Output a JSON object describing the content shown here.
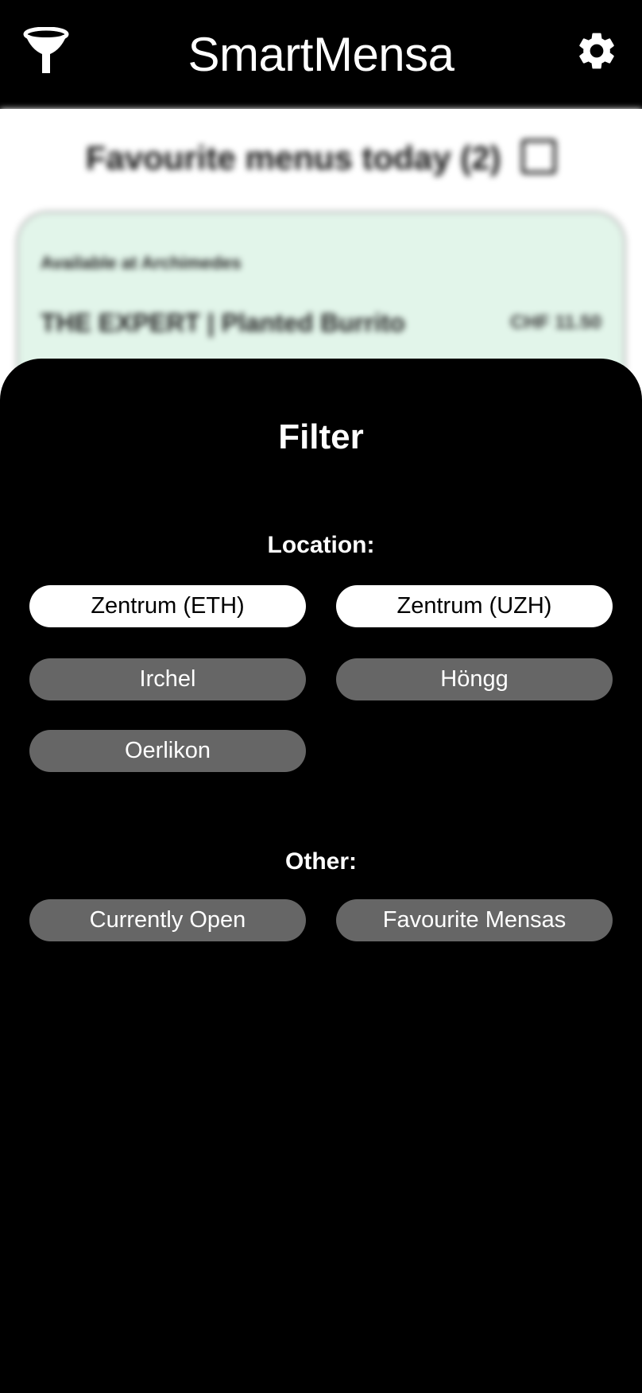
{
  "app": {
    "title": "SmartMensa",
    "filter_icon": "filter-funnel-icon",
    "settings_icon": "gear-icon"
  },
  "background": {
    "favourites_heading": "Favourite menus today (2)",
    "edit_icon": "edit-icon",
    "card": {
      "availability": "Available at Archimedes",
      "menu_name": "THE EXPERT | Planted Burrito",
      "price": "CHF 11.50"
    }
  },
  "filter_sheet": {
    "title": "Filter",
    "location_label": "Location:",
    "locations": [
      {
        "label": "Zentrum (ETH)",
        "selected": true
      },
      {
        "label": "Zentrum (UZH)",
        "selected": true
      },
      {
        "label": "Irchel",
        "selected": false
      },
      {
        "label": "Höngg",
        "selected": false
      },
      {
        "label": "Oerlikon",
        "selected": false
      }
    ],
    "other_label": "Other:",
    "other": [
      {
        "label": "Currently Open",
        "selected": false
      },
      {
        "label": "Favourite Mensas",
        "selected": false
      }
    ]
  },
  "colors": {
    "bar_background": "#000000",
    "chip_selected": "#ffffff",
    "chip_unselected": "#666666",
    "card_background": "#e2f5ea"
  }
}
